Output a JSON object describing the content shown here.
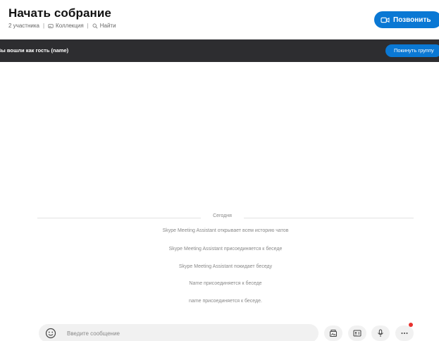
{
  "header": {
    "title": "Начать собрание",
    "participants": "2 участника",
    "separator": "|",
    "gallery_label": "Коллекция",
    "find_label": "Найти",
    "call_label": "Позвонить"
  },
  "guest_bar": {
    "text": "Вы вошли как гость (name)",
    "leave_label": "Покинуть группу"
  },
  "conversation": {
    "date_label": "Сегодня",
    "messages": [
      "Skype Meeting Assistant открывает всем историю чатов",
      "Skype Meeting Assistant присоединяется к беседе",
      "Skype Meeting Assistant покидает беседу",
      "Name присоединяется к беседе",
      "name присоединяется к беседе."
    ]
  },
  "composer": {
    "placeholder": "Введите сообщение"
  },
  "colors": {
    "accent": "#0a78d4",
    "banner": "#2d2d30",
    "notification": "#e8312e"
  },
  "icons": [
    "gallery-icon",
    "search-icon",
    "video-call-icon",
    "emoji-icon",
    "media-gallery-icon",
    "contact-card-icon",
    "microphone-icon",
    "more-icon"
  ]
}
